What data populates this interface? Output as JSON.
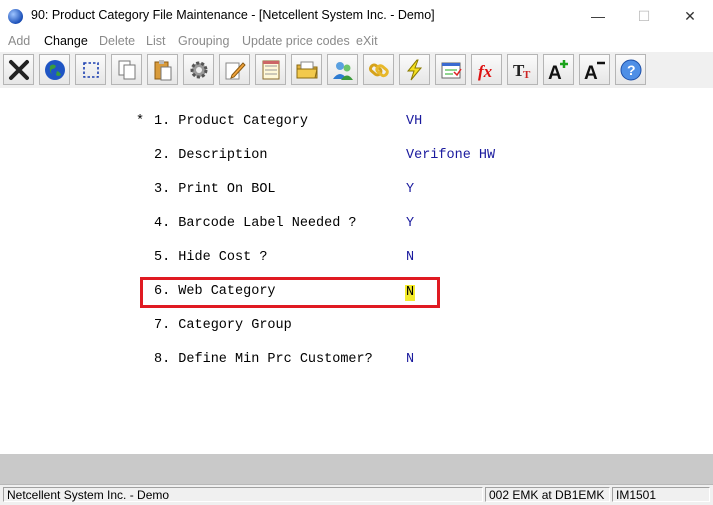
{
  "window": {
    "title": "90: Product Category File Maintenance - [Netcellent System Inc. - Demo]",
    "min_glyph": "—",
    "max_glyph": "☐",
    "close_glyph": "✕"
  },
  "menu": {
    "items": [
      {
        "label": "Add",
        "enabled": false
      },
      {
        "label": "Change",
        "enabled": true
      },
      {
        "label": "Delete",
        "enabled": false
      },
      {
        "label": "List",
        "enabled": false
      },
      {
        "label": "Grouping",
        "enabled": false
      },
      {
        "label": "Update price codes",
        "enabled": false
      },
      {
        "label": "eXit",
        "enabled": false
      }
    ]
  },
  "toolbar": {
    "icons": [
      "close-x-icon",
      "globe-icon",
      "select-icon",
      "copy-icon",
      "paste-icon",
      "settings-gear-icon",
      "edit-pencil-icon",
      "notepad-icon",
      "open-folder-icon",
      "users-icon",
      "link-icon",
      "lightning-icon",
      "calculator-icon",
      "fx-function-icon",
      "text-format-icon",
      "font-increase-icon",
      "font-decrease-icon",
      "help-icon"
    ]
  },
  "form": {
    "current_field_marker": "*",
    "fields": [
      {
        "label": "1. Product Category",
        "value": "VH"
      },
      {
        "label": "2. Description",
        "value": "Verifone HW"
      },
      {
        "label": "3. Print On BOL",
        "value": "Y"
      },
      {
        "label": "4. Barcode Label Needed ?",
        "value": "Y"
      },
      {
        "label": "5. Hide Cost ?",
        "value": "N"
      },
      {
        "label": "6. Web Category",
        "value": "N"
      },
      {
        "label": "7. Category Group",
        "value": ""
      },
      {
        "label": "8. Define Min Prc Customer?",
        "value": "N"
      }
    ]
  },
  "status": {
    "company": "Netcellent System Inc. - Demo",
    "session": "002 EMK at DB1EMK",
    "program": "IM1501"
  },
  "colors": {
    "value_text": "#1a1a9e",
    "highlight_border": "#e01a22",
    "cursor_bg": "#f3ea2a"
  }
}
